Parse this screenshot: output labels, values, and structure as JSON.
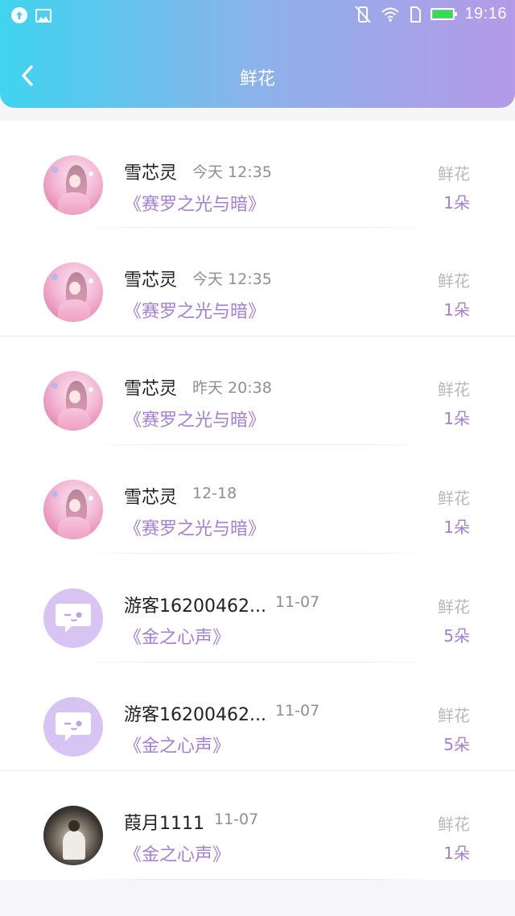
{
  "status_bar": {
    "time": "19:16",
    "left_icons": [
      "upload-icon",
      "image-icon"
    ],
    "right_icons": [
      "vibrate-icon",
      "wifi-icon",
      "sim-icon",
      "battery-icon"
    ]
  },
  "header": {
    "title": "鲜花",
    "back_icon": "chevron-left-icon",
    "gradient_colors": [
      "#3fd4ef",
      "#b49ae8"
    ]
  },
  "records": [
    {
      "name": "雪芯灵",
      "time": "今天 12:35",
      "book": "《赛罗之光与暗》",
      "gift_type": "鲜花",
      "gift_count": "1朵",
      "avatar": "pink-anime-avatar"
    },
    {
      "name": "雪芯灵",
      "time": "今天 12:35",
      "book": "《赛罗之光与暗》",
      "gift_type": "鲜花",
      "gift_count": "1朵",
      "avatar": "pink-anime-avatar"
    },
    {
      "name": "雪芯灵",
      "time": "昨天 20:38",
      "book": "《赛罗之光与暗》",
      "gift_type": "鲜花",
      "gift_count": "1朵",
      "avatar": "pink-anime-avatar"
    },
    {
      "name": "雪芯灵",
      "time": "12-18",
      "book": "《赛罗之光与暗》",
      "gift_type": "鲜花",
      "gift_count": "1朵",
      "avatar": "pink-anime-avatar"
    },
    {
      "name": "游客16200462...",
      "time": "11-07",
      "book": "《金之心声》",
      "gift_type": "鲜花",
      "gift_count": "5朵",
      "avatar": "default-chat-avatar"
    },
    {
      "name": "游客16200462...",
      "time": "11-07",
      "book": "《金之心声》",
      "gift_type": "鲜花",
      "gift_count": "5朵",
      "avatar": "default-chat-avatar"
    },
    {
      "name": "葭月1111",
      "time": "11-07",
      "book": "《金之心声》",
      "gift_type": "鲜花",
      "gift_count": "1朵",
      "avatar": "dark-portrait-avatar"
    }
  ],
  "colors": {
    "accent": "#a47fd6",
    "name_text": "#222222",
    "muted_text": "#8e8e93",
    "gift_label": "#b8b8bc",
    "default_avatar_bg": "#d8c4f2"
  }
}
